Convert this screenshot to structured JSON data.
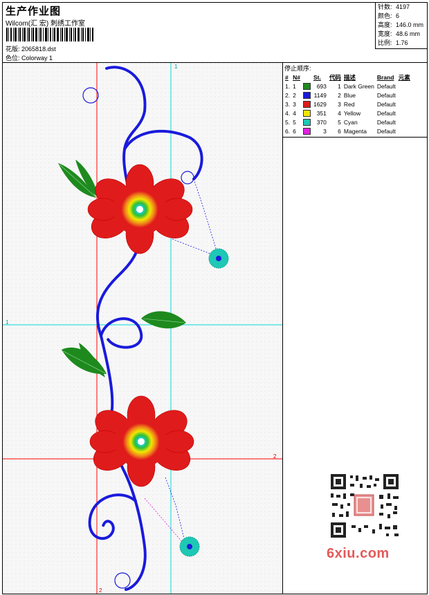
{
  "header": {
    "title": "生产作业图",
    "company": "Wilcom(汇 宏) 刺绣工作室",
    "design_label": "花版:",
    "design_value": "2065818.dst",
    "colorway_label": "色位:",
    "colorway_value": "Colorway 1"
  },
  "stats": [
    {
      "label": "针数:",
      "value": "4197"
    },
    {
      "label": "颜色:",
      "value": "6"
    },
    {
      "label": "高度:",
      "value": "146.0 mm"
    },
    {
      "label": "宽度:",
      "value": "48.6 mm"
    },
    {
      "label": "比例:",
      "value": "1.76"
    }
  ],
  "guides": {
    "v1": "1",
    "h1": "1",
    "h2": "2",
    "v2": "2"
  },
  "stop_sequence": {
    "title": "停止顺序:",
    "columns": [
      "#",
      "N#",
      "St.",
      "代码",
      "描述",
      "Brand",
      "元素"
    ],
    "rows": [
      {
        "idx": "1.",
        "n": "1",
        "st": "693",
        "code": "1",
        "desc": "Dark Green",
        "brand": "Default",
        "color": "#1e8a1e"
      },
      {
        "idx": "2.",
        "n": "2",
        "st": "1149",
        "code": "2",
        "desc": "Blue",
        "brand": "Default",
        "color": "#1a1adc"
      },
      {
        "idx": "3.",
        "n": "3",
        "st": "1629",
        "code": "3",
        "desc": "Red",
        "brand": "Default",
        "color": "#e01b1b"
      },
      {
        "idx": "4.",
        "n": "4",
        "st": "351",
        "code": "4",
        "desc": "Yellow",
        "brand": "Default",
        "color": "#f2e600"
      },
      {
        "idx": "5.",
        "n": "5",
        "st": "370",
        "code": "5",
        "desc": "Cyan",
        "brand": "Default",
        "color": "#1ec8b4"
      },
      {
        "idx": "6.",
        "n": "6",
        "st": "3",
        "code": "6",
        "desc": "Magenta",
        "brand": "Default",
        "color": "#e020e0"
      }
    ]
  },
  "watermark": "6xiu.com",
  "colors": {
    "guide_red": "#ff0000",
    "guide_cyan": "#00d8d8",
    "thread_blue": "#1a1adc",
    "thread_red": "#e01b1b",
    "thread_green": "#1e8a1e",
    "thread_yellow": "#f2e600",
    "thread_cyan": "#1ec8b4"
  }
}
